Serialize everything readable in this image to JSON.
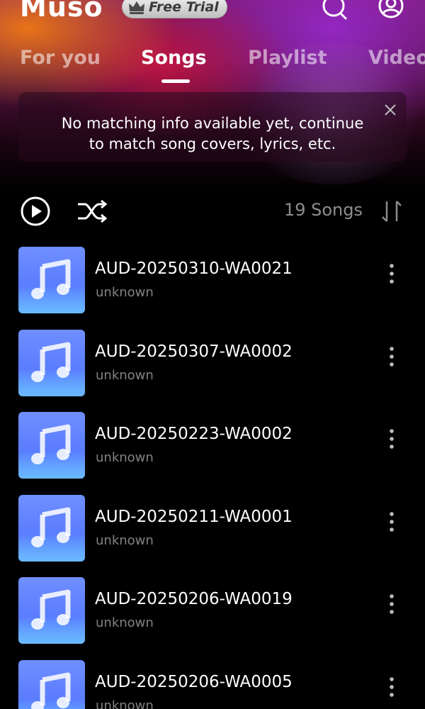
{
  "header": {
    "logo": "Muso",
    "trial_label": "Free Trial",
    "icons": [
      "search-icon",
      "profile-icon",
      "crown-icon"
    ]
  },
  "tabs": [
    {
      "label": "For you",
      "active": false
    },
    {
      "label": "Songs",
      "active": true
    },
    {
      "label": "Playlist",
      "active": false
    },
    {
      "label": "Video",
      "active": false
    }
  ],
  "banner": {
    "line1": "No matching info available yet, continue",
    "line2": "to match song covers, lyrics, etc."
  },
  "controls": {
    "song_count": "19 Songs",
    "icons": [
      "play-circle-icon",
      "shuffle-icon",
      "sort-icon"
    ]
  },
  "songs": [
    {
      "title": "AUD-20250310-WA0021",
      "artist": "unknown"
    },
    {
      "title": "AUD-20250307-WA0002",
      "artist": "unknown"
    },
    {
      "title": "AUD-20250223-WA0002",
      "artist": "unknown"
    },
    {
      "title": "AUD-20250211-WA0001",
      "artist": "unknown"
    },
    {
      "title": "AUD-20250206-WA0019",
      "artist": "unknown"
    },
    {
      "title": "AUD-20250206-WA0005",
      "artist": "unknown"
    }
  ],
  "colors": {
    "background": "#000000",
    "cover_blue": "#5a7cff",
    "muted_text": "#8c8c8c"
  }
}
